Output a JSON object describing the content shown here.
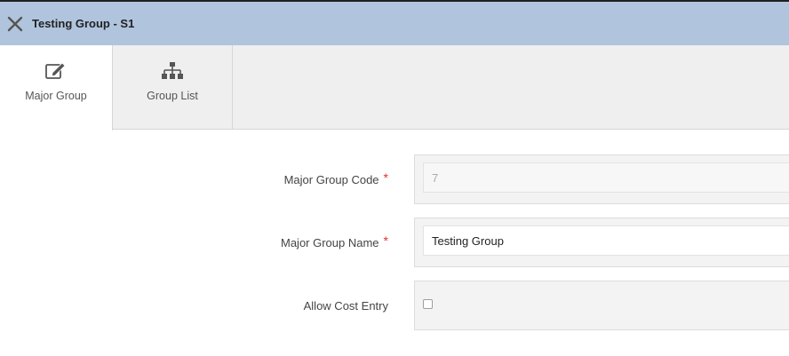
{
  "window": {
    "title": "Testing Group - S1",
    "close_icon": "close-icon"
  },
  "tabs": [
    {
      "label": "Major Group",
      "icon": "edit-icon",
      "active": true
    },
    {
      "label": "Group List",
      "icon": "hierarchy-icon",
      "active": false
    }
  ],
  "form": {
    "code": {
      "label": "Major Group Code",
      "required_mark": "*",
      "value": "7"
    },
    "name": {
      "label": "Major Group Name",
      "required_mark": "*",
      "value": "Testing Group"
    },
    "cost": {
      "label": "Allow Cost Entry",
      "checked": false
    }
  },
  "colors": {
    "titlebar": "#b0c4de",
    "required": "#e0322d",
    "tabbar": "#efefef"
  }
}
